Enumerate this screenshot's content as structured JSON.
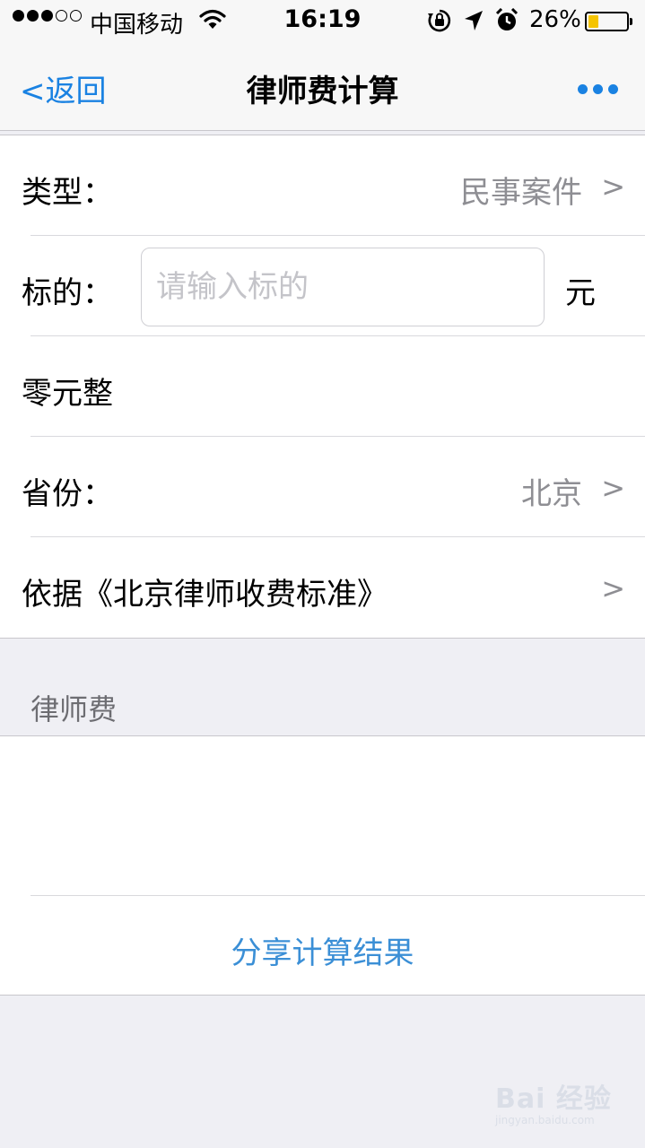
{
  "status_bar": {
    "carrier": "中国移动",
    "time": "16:19",
    "battery_percent": "26%",
    "battery_level": 0.26,
    "signal_bars_filled": 3,
    "signal_bars_total": 5,
    "icons": [
      "wifi-icon",
      "rotation-lock-icon",
      "location-arrow-icon",
      "alarm-icon",
      "battery-icon"
    ]
  },
  "nav": {
    "back_label": "<返回",
    "title": "律师费计算",
    "more_icon": "more-dots-icon",
    "accent_color": "#1a82e2"
  },
  "form": {
    "type_label": "类型：",
    "type_value": "民事案件",
    "subject_label": "标的：",
    "subject_placeholder": "请输入标的",
    "subject_value": "",
    "subject_unit": "元",
    "amount_words": "零元整",
    "province_label": "省份：",
    "province_value": "北京",
    "basis_label": "依据《北京律师收费标准》",
    "chevron": ">"
  },
  "result": {
    "section_title": "律师费",
    "value": "",
    "share_label": "分享计算结果",
    "share_color": "#3b8fd6"
  },
  "watermark": {
    "main": "Bai 经验",
    "sub": "jingyan.baidu.com"
  }
}
